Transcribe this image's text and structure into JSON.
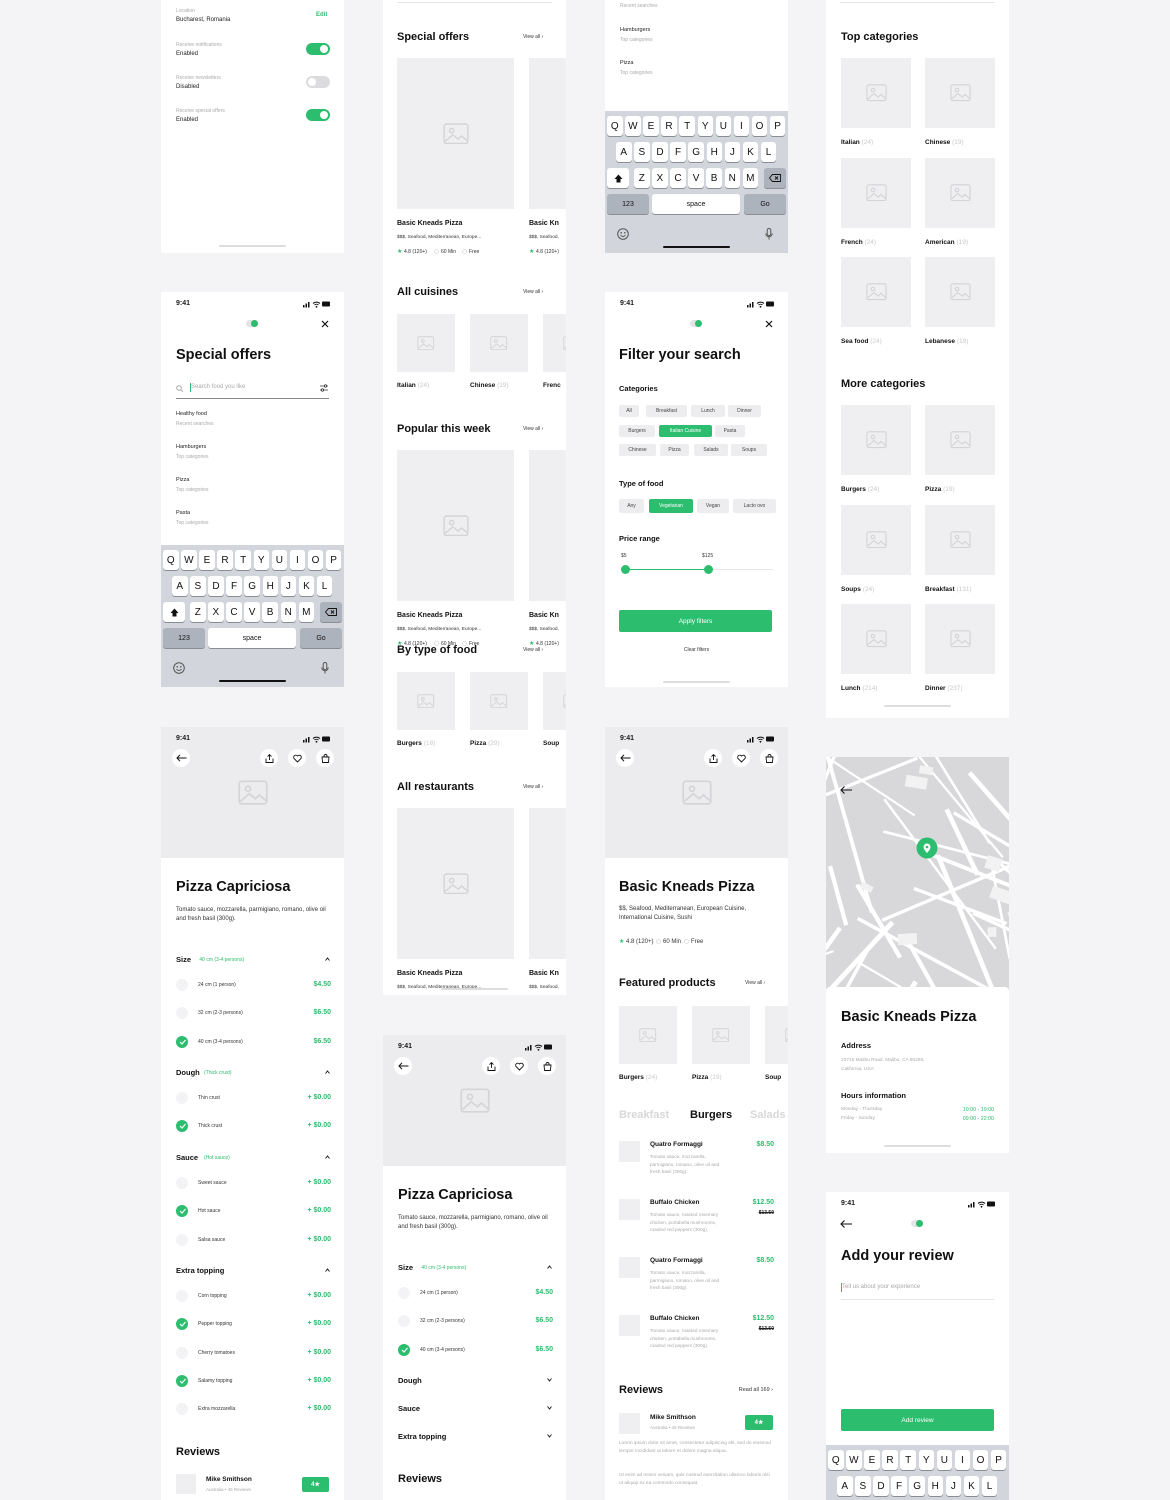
{
  "colors": {
    "accent": "#2dbd6e",
    "background": "#f4f4f6",
    "placeholder": "#efeff1",
    "keyboard": "#d2d5db"
  },
  "status": {
    "time": "9:41"
  },
  "settings": {
    "location_label": "Location",
    "location": "Bucharest, Romania",
    "edit": "Edit",
    "toggles": [
      {
        "label": "Receive notifications",
        "value": "Enabled",
        "on": true
      },
      {
        "label": "Receive newsletters",
        "value": "Disabled",
        "on": false
      },
      {
        "label": "Receive special offers",
        "value": "Enabled",
        "on": true
      }
    ]
  },
  "search": {
    "title": "Special offers",
    "placeholder": "Search food you like",
    "items": [
      {
        "title": "Healthy food",
        "sub": "Recent searches"
      },
      {
        "title": "Hamburgers",
        "sub": "Top categories"
      },
      {
        "title": "Pizza",
        "sub": "Top categories"
      },
      {
        "title": "Pasta",
        "sub": "Top categories"
      }
    ]
  },
  "keyboard": {
    "rows": [
      [
        "Q",
        "W",
        "E",
        "R",
        "T",
        "Y",
        "U",
        "I",
        "O",
        "P"
      ],
      [
        "A",
        "S",
        "D",
        "F",
        "G",
        "H",
        "J",
        "K",
        "L"
      ],
      [
        "Z",
        "X",
        "C",
        "V",
        "B",
        "N",
        "M"
      ]
    ],
    "numbers": "123",
    "space": "space",
    "go": "Go"
  },
  "results": {
    "recent": "Recent searches",
    "items": [
      {
        "title": "Hamburgers",
        "sub": "Top categories"
      },
      {
        "title": "Pizza",
        "sub": "Top categories"
      }
    ]
  },
  "home": {
    "search_placeholder": "Search food you like",
    "view_all": "View all ›",
    "card": {
      "title": "Basic Kneads Pizza",
      "meta": "$$$, Seafood, Mediterranean, Europe...",
      "rating": "4.8 (120+)",
      "time": "60 Min",
      "delivery": "Free"
    },
    "card_partial": {
      "title": "Basic Kn",
      "meta": "$$$, Seafood, "
    },
    "sections": {
      "special": "Special offers",
      "cuisines": "All cuisines",
      "popular": "Popular this week",
      "type": "By type of food",
      "restaurants": "All restaurants"
    },
    "cuisines": [
      {
        "name": "Italian",
        "count": "(24)"
      },
      {
        "name": "Chinese",
        "count": "(19)"
      },
      {
        "name": "Frenc",
        "count": ""
      }
    ],
    "types": [
      {
        "name": "Burgers",
        "count": "(18)"
      },
      {
        "name": "Pizza",
        "count": "(29)"
      },
      {
        "name": "Soup",
        "count": ""
      }
    ]
  },
  "pizza": {
    "title": "Pizza Capriciosa",
    "desc": "Tomato sauce, mozzarella, parmigiano, romano, olive oil and fresh basil (300g).",
    "groups": [
      {
        "name": "Size",
        "selected": "40 cm (3-4 persons)",
        "options": [
          {
            "label": "24 cm (1 person)",
            "price": "$4.50",
            "checked": false
          },
          {
            "label": "32 cm (2-3 persons)",
            "price": "$6.50",
            "checked": false
          },
          {
            "label": "40 cm (3-4 persons)",
            "price": "$6.50",
            "checked": true
          }
        ]
      },
      {
        "name": "Dough",
        "selected": "(Thick crust)",
        "options": [
          {
            "label": "Thin crust",
            "price": "+ $0.00",
            "checked": false
          },
          {
            "label": "Thick crust",
            "price": "+ $0.00",
            "checked": true
          }
        ]
      },
      {
        "name": "Sauce",
        "selected": "(Hot sauce)",
        "options": [
          {
            "label": "Sweet sauce",
            "price": "+ $0.00",
            "checked": false
          },
          {
            "label": "Hot sauce",
            "price": "+ $0.00",
            "checked": true
          },
          {
            "label": "Salsa sauce",
            "price": "+ $0.00",
            "checked": false
          }
        ]
      },
      {
        "name": "Extra topping",
        "selected": "",
        "options": [
          {
            "label": "Corn topping",
            "price": "+ $0.00",
            "checked": false
          },
          {
            "label": "Pepper topping",
            "price": "+ $0.00",
            "checked": true
          },
          {
            "label": "Cherry tomatoes",
            "price": "+ $0.00",
            "checked": false
          },
          {
            "label": "Salamy topping",
            "price": "+ $0.00",
            "checked": true
          },
          {
            "label": "Extra mozzarella",
            "price": "+ $0.00",
            "checked": false
          }
        ]
      }
    ],
    "reviews_title": "Reviews",
    "reviewer": "Mike Smithson",
    "reviewer_sub": "Australia • 45 Reviews",
    "rating": "4★"
  },
  "filter": {
    "title": "Filter your search",
    "categories_title": "Categories",
    "categories": [
      [
        {
          "label": "All",
          "on": false
        },
        {
          "label": "Breakfast",
          "on": false
        },
        {
          "label": "Lunch",
          "on": false
        },
        {
          "label": "Dinner",
          "on": false
        }
      ],
      [
        {
          "label": "Burgers",
          "on": false
        },
        {
          "label": "Italian Cuisine",
          "on": true
        },
        {
          "label": "Pasta",
          "on": false
        }
      ],
      [
        {
          "label": "Chinese",
          "on": false
        },
        {
          "label": "Pizza",
          "on": false
        },
        {
          "label": "Salads",
          "on": false
        },
        {
          "label": "Soups",
          "on": false
        }
      ]
    ],
    "type_title": "Type of food",
    "types": [
      {
        "label": "Any",
        "on": false
      },
      {
        "label": "Vegetarian",
        "on": true
      },
      {
        "label": "Vegan",
        "on": false
      },
      {
        "label": "Lacto ovo",
        "on": false
      }
    ],
    "price_title": "Price range",
    "price_min": "$5",
    "price_max": "$125",
    "apply": "Apply filters",
    "clear": "Clear filters"
  },
  "restaurant": {
    "title": "Basic Kneads Pizza",
    "desc": "$$, Seafood, Mediterranean, European Cuisine, International Cuisine, Sushi",
    "rating": "4.8 (120+)",
    "time": "60 Min",
    "delivery": "Free",
    "featured_title": "Featured products",
    "view_all": "View all ›",
    "featured": [
      {
        "name": "Burgers",
        "count": "(24)"
      },
      {
        "name": "Pizza",
        "count": "(19)"
      },
      {
        "name": "Soup",
        "count": ""
      }
    ],
    "tabs": [
      {
        "label": "Breakfast",
        "active": false
      },
      {
        "label": "Burgers",
        "active": true
      },
      {
        "label": "Salads",
        "active": false
      }
    ],
    "products": [
      {
        "name": "Quatro Formaggi",
        "desc": "Tomato sauce, mozzarella, parmigiano, romano, olive oil and fresh basil (300g).",
        "price": "$8.50",
        "old_price": ""
      },
      {
        "name": "Buffalo Chicken",
        "desc": "Tomato sauce, roasted rosemary chicken, portabella mushrooms, roasted red peppers (300g).",
        "price": "$12.50",
        "old_price": "$13.50"
      },
      {
        "name": "Quatro Formaggi",
        "desc": "Tomato sauce, mozzarella, parmigiano, romano, olive oil and fresh basil (300g).",
        "price": "$8.50",
        "old_price": ""
      },
      {
        "name": "Buffalo Chicken",
        "desc": "Tomato sauce, roasted rosemary chicken, portabella mushrooms, roasted red peppers (300g).",
        "price": "$12.50",
        "old_price": "$13.50"
      }
    ],
    "reviews_title": "Reviews",
    "read_all": "Read all 169 ›",
    "reviewer": "Mike Smithson",
    "reviewer_sub": "Australia • 45 Reviews",
    "rating_badge": "4★",
    "review_p1": "Lorem ipsum dolor sit amet, consectetur adipiscing elit, sed do eiusmod tempor incididunt ut labore et dolore magna aliqua.",
    "review_p2": "Ut enim ad minim veniam, quis nostrud exercitation ullamco laboris nisi ut aliquip ex ea commodo consequat."
  },
  "categories": {
    "search_placeholder": "Search food you like",
    "top_title": "Top categories",
    "top": [
      {
        "name": "Italian",
        "count": "(24)"
      },
      {
        "name": "Chinese",
        "count": "(19)"
      },
      {
        "name": "French",
        "count": "(24)"
      },
      {
        "name": "American",
        "count": "(19)"
      },
      {
        "name": "Sea food",
        "count": "(24)"
      },
      {
        "name": "Lebanese",
        "count": "(19)"
      }
    ],
    "more_title": "More categories",
    "more": [
      {
        "name": "Burgers",
        "count": "(24)"
      },
      {
        "name": "Pizza",
        "count": "(19)"
      },
      {
        "name": "Soups",
        "count": "(24)"
      },
      {
        "name": "Breakfast",
        "count": "(131)"
      },
      {
        "name": "Lunch",
        "count": "(214)"
      },
      {
        "name": "Dinner",
        "count": "(237)"
      }
    ]
  },
  "info": {
    "title": "Basic Kneads Pizza",
    "address_title": "Address",
    "address": "23715 Malibu Road, Malibu, CA 90265, California, USA",
    "hours_title": "Hours information",
    "hours": [
      {
        "days": "Monday - Thursday",
        "time": "10:00 - 19:00"
      },
      {
        "days": "Friday - Sunday",
        "time": "09:00 - 22:00"
      }
    ]
  },
  "review": {
    "title": "Add your review",
    "placeholder": "Tell us about your experience",
    "button": "Add review"
  }
}
